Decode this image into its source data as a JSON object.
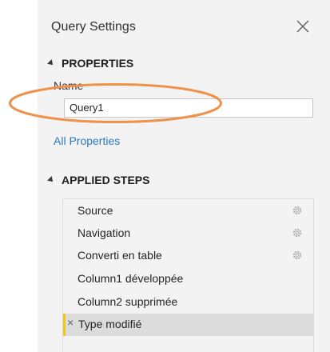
{
  "panel": {
    "title": "Query Settings",
    "close_icon": "close-icon"
  },
  "properties": {
    "header": "PROPERTIES",
    "name_label": "Name",
    "name_value": "Query1",
    "all_properties_link": "All Properties"
  },
  "applied_steps": {
    "header": "APPLIED STEPS",
    "steps": [
      {
        "label": "Source",
        "icon": "gear-icon"
      },
      {
        "label": "Navigation",
        "icon": "gear-icon"
      },
      {
        "label": "Converti en table",
        "icon": "gear-icon"
      },
      {
        "label": "Column1 développée"
      },
      {
        "label": "Column2 supprimée"
      },
      {
        "label": "Type modifié",
        "selected": true,
        "delete_icon": "×"
      }
    ]
  },
  "colors": {
    "highlight_ellipse": "#f0914a",
    "selected_step_marker": "#f2c811",
    "link": "#2b78c5"
  }
}
